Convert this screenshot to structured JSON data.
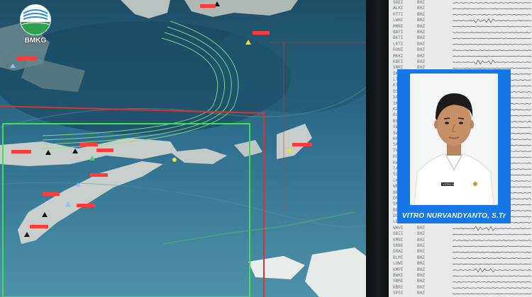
{
  "logo": {
    "text": "BMKG"
  },
  "presenter": {
    "name": "VITRO NURVANDYANTO, S.Tr",
    "nametag": "VITRO N."
  },
  "colors": {
    "sea": "#2c6e8f",
    "deep_sea": "#1d4e68",
    "land": "#b9c4c2",
    "region_green": "#3ee04e",
    "region_red": "#d8332c",
    "name_card": "#1677e6"
  },
  "seismograph": {
    "stations": [
      "SOEI",
      "ALKI",
      "KTTI",
      "LWNI",
      "MMRI",
      "BATI",
      "BKTI",
      "LRTI",
      "RONI",
      "MKKI",
      "KDFI",
      "SMRI",
      "SMSI",
      "LTRI",
      "KTPI",
      "DSRI",
      "SAEI",
      "SMRI",
      "KPMI",
      "BLMI",
      "BSEI",
      "SBII",
      "SWI",
      "KMRI",
      "SARI",
      "TMBI",
      "KCHI",
      "KWMI",
      "TANI",
      "SOHI",
      "LMBI",
      "WBSI",
      "NRI",
      "ONMI",
      "SMNI",
      "BBRI",
      "DOMI",
      "LBUI",
      "WHVI",
      "SBII",
      "KMNI",
      "SRBI",
      "GRAI",
      "BLMI",
      "LUWI",
      "KMPI",
      "BWKI",
      "SBMI",
      "KBRI",
      "SPSI"
    ],
    "channel": "BHZ"
  }
}
